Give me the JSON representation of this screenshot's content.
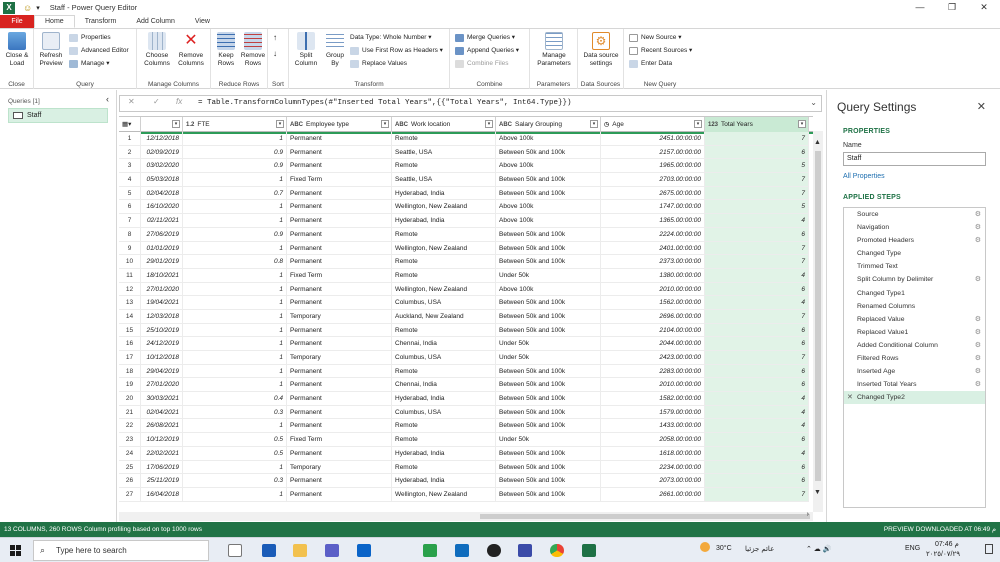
{
  "window": {
    "title": "Staff - Power Query Editor",
    "app_icon": "X"
  },
  "tabs": [
    "File",
    "Home",
    "Transform",
    "Add Column",
    "View"
  ],
  "ribbon": {
    "close_group": {
      "btn": "Close &\nLoad",
      "label": "Close"
    },
    "query_group": {
      "refresh": "Refresh\nPreview",
      "properties": "Properties",
      "advanced_editor": "Advanced Editor",
      "manage": "Manage",
      "label": "Query"
    },
    "manage_columns": {
      "choose": "Choose\nColumns",
      "remove": "Remove\nColumns",
      "label": "Manage Columns"
    },
    "reduce_rows": {
      "keep": "Keep\nRows",
      "remove": "Remove\nRows",
      "label": "Reduce Rows"
    },
    "sort": {
      "label": "Sort"
    },
    "transform": {
      "split": "Split\nColumn",
      "group": "Group\nBy",
      "data_type": "Data Type: Whole Number",
      "first_row": "Use First Row as Headers",
      "replace": "Replace Values",
      "label": "Transform"
    },
    "combine": {
      "merge": "Merge Queries",
      "append": "Append Queries",
      "combine_files": "Combine Files",
      "label": "Combine"
    },
    "parameters": {
      "manage": "Manage\nParameters",
      "label": "Parameters"
    },
    "data_sources": {
      "settings": "Data source\nsettings",
      "label": "Data Sources"
    },
    "new_query": {
      "new_source": "New Source",
      "recent": "Recent Sources",
      "enter": "Enter Data",
      "label": "New Query"
    }
  },
  "queries": {
    "header": "Queries [1]",
    "items": [
      "Staff"
    ]
  },
  "formula": "= Table.TransformColumnTypes(#\"Inserted Total Years\",{{\"Total Years\", Int64.Type}})",
  "columns": [
    {
      "type": "1.2",
      "name": "FTE"
    },
    {
      "type": "ABC",
      "name": "Employee type"
    },
    {
      "type": "ABC",
      "name": "Work location"
    },
    {
      "type": "ABC",
      "name": "Salary Grouping"
    },
    {
      "type": "◷",
      "name": "Age"
    },
    {
      "type": "123",
      "name": "Total Years"
    }
  ],
  "rows": [
    [
      "12/12/2018",
      "1",
      "Permanent",
      "Remote",
      "Above 100k",
      "2451.00:00:00",
      "7"
    ],
    [
      "02/09/2019",
      "0.9",
      "Permanent",
      "Seattle, USA",
      "Between 50k and 100k",
      "2157.00:00:00",
      "6"
    ],
    [
      "03/02/2020",
      "0.9",
      "Permanent",
      "Remote",
      "Above 100k",
      "1965.00:00:00",
      "5"
    ],
    [
      "05/03/2018",
      "1",
      "Fixed Term",
      "Seattle, USA",
      "Between 50k and 100k",
      "2703.00:00:00",
      "7"
    ],
    [
      "02/04/2018",
      "0.7",
      "Permanent",
      "Hyderabad, India",
      "Between 50k and 100k",
      "2675.00:00:00",
      "7"
    ],
    [
      "16/10/2020",
      "1",
      "Permanent",
      "Wellington, New Zealand",
      "Above 100k",
      "1747.00:00:00",
      "5"
    ],
    [
      "02/11/2021",
      "1",
      "Permanent",
      "Hyderabad, India",
      "Above 100k",
      "1365.00:00:00",
      "4"
    ],
    [
      "27/06/2019",
      "0.9",
      "Permanent",
      "Remote",
      "Between 50k and 100k",
      "2224.00:00:00",
      "6"
    ],
    [
      "01/01/2019",
      "1",
      "Permanent",
      "Wellington, New Zealand",
      "Between 50k and 100k",
      "2401.00:00:00",
      "7"
    ],
    [
      "29/01/2019",
      "0.8",
      "Permanent",
      "Remote",
      "Between 50k and 100k",
      "2373.00:00:00",
      "7"
    ],
    [
      "18/10/2021",
      "1",
      "Fixed Term",
      "Remote",
      "Under 50k",
      "1380.00:00:00",
      "4"
    ],
    [
      "27/01/2020",
      "1",
      "Permanent",
      "Wellington, New Zealand",
      "Above 100k",
      "2010.00:00:00",
      "6"
    ],
    [
      "19/04/2021",
      "1",
      "Permanent",
      "Columbus, USA",
      "Between 50k and 100k",
      "1562.00:00:00",
      "4"
    ],
    [
      "12/03/2018",
      "1",
      "Temporary",
      "Auckland, New Zealand",
      "Between 50k and 100k",
      "2696.00:00:00",
      "7"
    ],
    [
      "25/10/2019",
      "1",
      "Permanent",
      "Remote",
      "Between 50k and 100k",
      "2104.00:00:00",
      "6"
    ],
    [
      "24/12/2019",
      "1",
      "Permanent",
      "Chennai, India",
      "Under 50k",
      "2044.00:00:00",
      "6"
    ],
    [
      "10/12/2018",
      "1",
      "Temporary",
      "Columbus, USA",
      "Under 50k",
      "2423.00:00:00",
      "7"
    ],
    [
      "29/04/2019",
      "1",
      "Permanent",
      "Remote",
      "Between 50k and 100k",
      "2283.00:00:00",
      "6"
    ],
    [
      "27/01/2020",
      "1",
      "Permanent",
      "Chennai, India",
      "Between 50k and 100k",
      "2010.00:00:00",
      "6"
    ],
    [
      "30/03/2021",
      "0.4",
      "Permanent",
      "Hyderabad, India",
      "Between 50k and 100k",
      "1582.00:00:00",
      "4"
    ],
    [
      "02/04/2021",
      "0.3",
      "Permanent",
      "Columbus, USA",
      "Between 50k and 100k",
      "1579.00:00:00",
      "4"
    ],
    [
      "26/08/2021",
      "1",
      "Permanent",
      "Remote",
      "Between 50k and 100k",
      "1433.00:00:00",
      "4"
    ],
    [
      "10/12/2019",
      "0.5",
      "Fixed Term",
      "Remote",
      "Under 50k",
      "2058.00:00:00",
      "6"
    ],
    [
      "22/02/2021",
      "0.5",
      "Permanent",
      "Hyderabad, India",
      "Between 50k and 100k",
      "1618.00:00:00",
      "4"
    ],
    [
      "17/06/2019",
      "1",
      "Temporary",
      "Remote",
      "Between 50k and 100k",
      "2234.00:00:00",
      "6"
    ],
    [
      "25/11/2019",
      "0.3",
      "Permanent",
      "Hyderabad, India",
      "Between 50k and 100k",
      "2073.00:00:00",
      "6"
    ],
    [
      "16/04/2018",
      "1",
      "Permanent",
      "Wellington, New Zealand",
      "Between 50k and 100k",
      "2661.00:00:00",
      "7"
    ]
  ],
  "settings": {
    "title": "Query Settings",
    "properties_header": "PROPERTIES",
    "name_label": "Name",
    "name_value": "Staff",
    "all_properties": "All Properties",
    "steps_header": "APPLIED STEPS",
    "steps": [
      {
        "label": "Source",
        "gear": true
      },
      {
        "label": "Navigation",
        "gear": true
      },
      {
        "label": "Promoted Headers",
        "gear": true
      },
      {
        "label": "Changed Type",
        "gear": false
      },
      {
        "label": "Trimmed Text",
        "gear": false
      },
      {
        "label": "Split Column by Delimiter",
        "gear": true
      },
      {
        "label": "Changed Type1",
        "gear": false
      },
      {
        "label": "Renamed Columns",
        "gear": false
      },
      {
        "label": "Replaced Value",
        "gear": true
      },
      {
        "label": "Replaced Value1",
        "gear": true
      },
      {
        "label": "Added Conditional Column",
        "gear": true
      },
      {
        "label": "Filtered Rows",
        "gear": true
      },
      {
        "label": "Inserted Age",
        "gear": true
      },
      {
        "label": "Inserted Total Years",
        "gear": true
      },
      {
        "label": "Changed Type2",
        "gear": false
      }
    ]
  },
  "status": {
    "left": "13 COLUMNS, 260 ROWS     Column profiling based on top 1000 rows",
    "right": "PREVIEW DOWNLOADED AT 06:49 م"
  },
  "taskbar": {
    "search_placeholder": "Type here to search",
    "temp": "30°C",
    "weather_text": "عائم جزئيا",
    "lang": "ENG",
    "time": "07:46 م",
    "date": "٢٠٢٥/٠٧/٢٩"
  }
}
